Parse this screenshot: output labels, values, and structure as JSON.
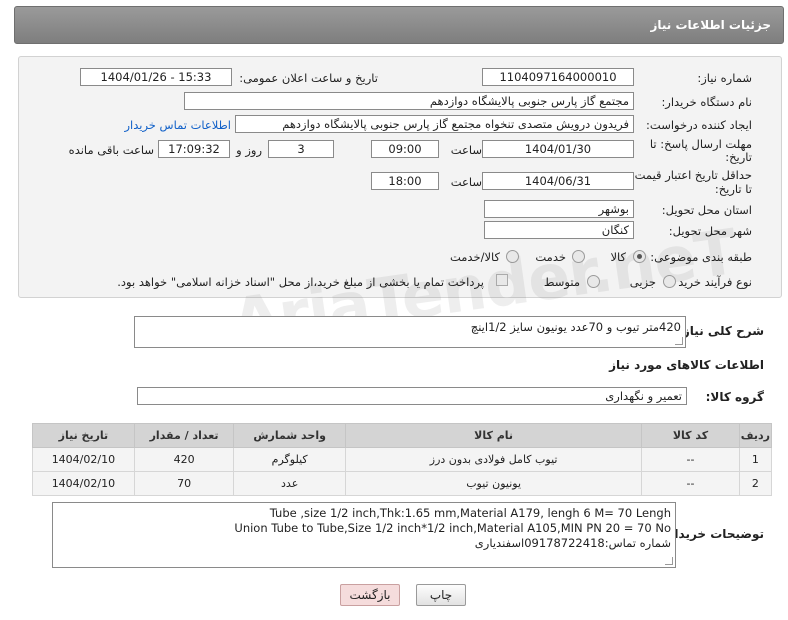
{
  "header": {
    "title": "جزئیات اطلاعات نیاز"
  },
  "form": {
    "need_number_label": "شماره نیاز:",
    "need_number": "1104097164000010",
    "announce_label": "تاریخ و ساعت اعلان عمومی:",
    "announce_value": "1404/01/26 - 15:33",
    "buyer_org_label": "نام دستگاه خریدار:",
    "buyer_org": "مجتمع گاز پارس جنوبی  پالایشگاه دوازدهم",
    "creator_label": "ایجاد کننده درخواست:",
    "creator": "فریدون درویش متصدی تنخواه مجتمع گاز پارس جنوبی  پالایشگاه دوازدهم",
    "contact_link": "اطلاعات تماس خریدار",
    "deadline_label_1": "مهلت ارسال پاسخ: تا",
    "deadline_label_2": "تاریخ:",
    "deadline_date": "1404/01/30",
    "time_label": "ساعت",
    "deadline_time": "09:00",
    "days_value": "3",
    "days_label": "روز و",
    "remaining_time": "17:09:32",
    "remaining_label": "ساعت باقی مانده",
    "validity_label_1": "حداقل تاریخ اعتبار قیمت:",
    "validity_label_2": "تا تاریخ:",
    "validity_date": "1404/06/31",
    "validity_time": "18:00",
    "province_label": "استان محل تحویل:",
    "province": "بوشهر",
    "city_label": "شهر محل تحویل:",
    "city": "کنگان",
    "category_label": "طبقه بندی موضوعی:",
    "category_options": [
      "کالا",
      "خدمت",
      "کالا/خدمت"
    ],
    "category_selected": "کالا",
    "process_label": "نوع فرآیند خرید :",
    "process_options": [
      "جزیی",
      "متوسط"
    ],
    "payment_note": "پرداخت تمام یا بخشی از مبلغ خرید،از محل \"اسناد خزانه اسلامی\" خواهد بود."
  },
  "summary": {
    "label": "شرح کلی نیاز:",
    "text": "420متر تیوب و 70عدد یونیون سایز 1/2اینچ"
  },
  "goods": {
    "section_title": "اطلاعات کالاهای مورد نیاز",
    "group_label": "گروه کالا:",
    "group_value": "تعمیر و نگهداری",
    "columns": [
      "ردیف",
      "کد کالا",
      "نام کالا",
      "واحد شمارش",
      "تعداد / مقدار",
      "تاریخ نیاز"
    ],
    "rows": [
      {
        "row": "1",
        "code": "--",
        "name": "تیوب کامل فولادی بدون درز",
        "unit": "کیلوگرم",
        "qty": "420",
        "date": "1404/02/10"
      },
      {
        "row": "2",
        "code": "--",
        "name": "یونیون تیوب",
        "unit": "عدد",
        "qty": "70",
        "date": "1404/02/10"
      }
    ]
  },
  "buyer_notes": {
    "label": "توضیحات خریدار:",
    "line1": "Tube ,size 1/2 inch,Thk:1.65 mm,Material A179, lengh 6 M= 70 Lengh",
    "line2": "Union Tube to Tube,Size 1/2 inch*1/2 inch,Material A105,MIN PN 20 = 70 No",
    "line3": "شماره تماس:09178722418اسفندیاری"
  },
  "buttons": {
    "print": "چاپ",
    "back": "بازگشت"
  },
  "watermark": "AriaTender.neT"
}
